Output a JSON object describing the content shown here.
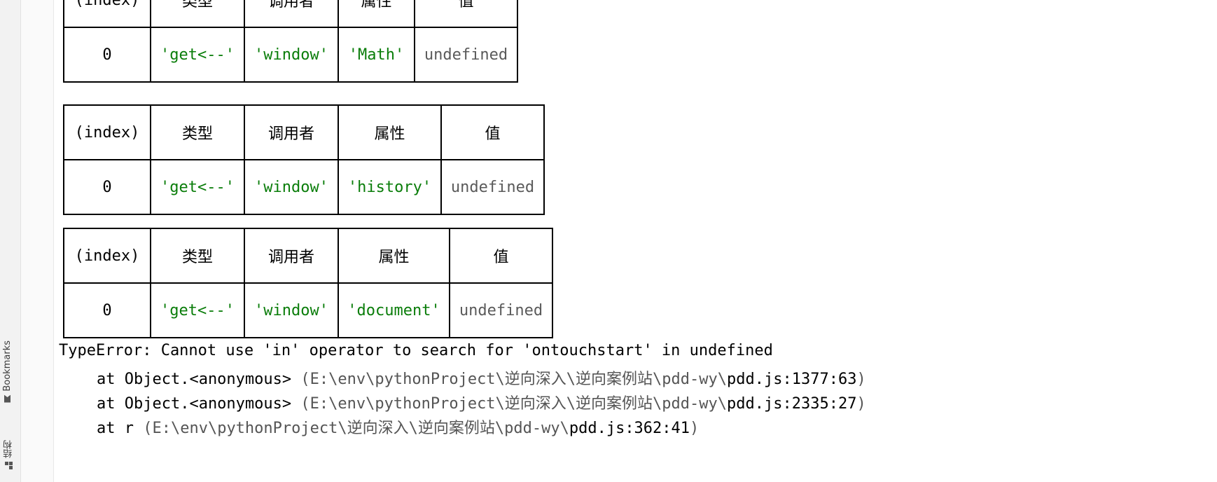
{
  "sidebar": {
    "bookmarks_label": "Bookmarks",
    "structure_label": "结构"
  },
  "tables": [
    {
      "headers": [
        "(index)",
        "类型",
        "调用者",
        "属性",
        "值"
      ],
      "row": [
        "0",
        "'get<--'",
        "'window'",
        "'Math'",
        "undefined"
      ]
    },
    {
      "headers": [
        "(index)",
        "类型",
        "调用者",
        "属性",
        "值"
      ],
      "row": [
        "0",
        "'get<--'",
        "'window'",
        "'history'",
        "undefined"
      ]
    },
    {
      "headers": [
        "(index)",
        "类型",
        "调用者",
        "属性",
        "值"
      ],
      "row": [
        "0",
        "'get<--'",
        "'window'",
        "'document'",
        "undefined"
      ]
    }
  ],
  "error": {
    "message": "TypeError: Cannot use 'in' operator to search for 'ontouchstart' in undefined",
    "stack": [
      {
        "at": "at Object.<anonymous> ",
        "path": "(E:\\env\\pythonProject\\逆向深入\\逆向案例站\\pdd-wy\\",
        "file": "pdd.js:1377:63",
        "close": ")"
      },
      {
        "at": "at Object.<anonymous> ",
        "path": "(E:\\env\\pythonProject\\逆向深入\\逆向案例站\\pdd-wy\\",
        "file": "pdd.js:2335:27",
        "close": ")"
      },
      {
        "at": "at r ",
        "path": "(E:\\env\\pythonProject\\逆向深入\\逆向案例站\\pdd-wy\\",
        "file": "pdd.js:362:41",
        "close": ")"
      }
    ]
  }
}
